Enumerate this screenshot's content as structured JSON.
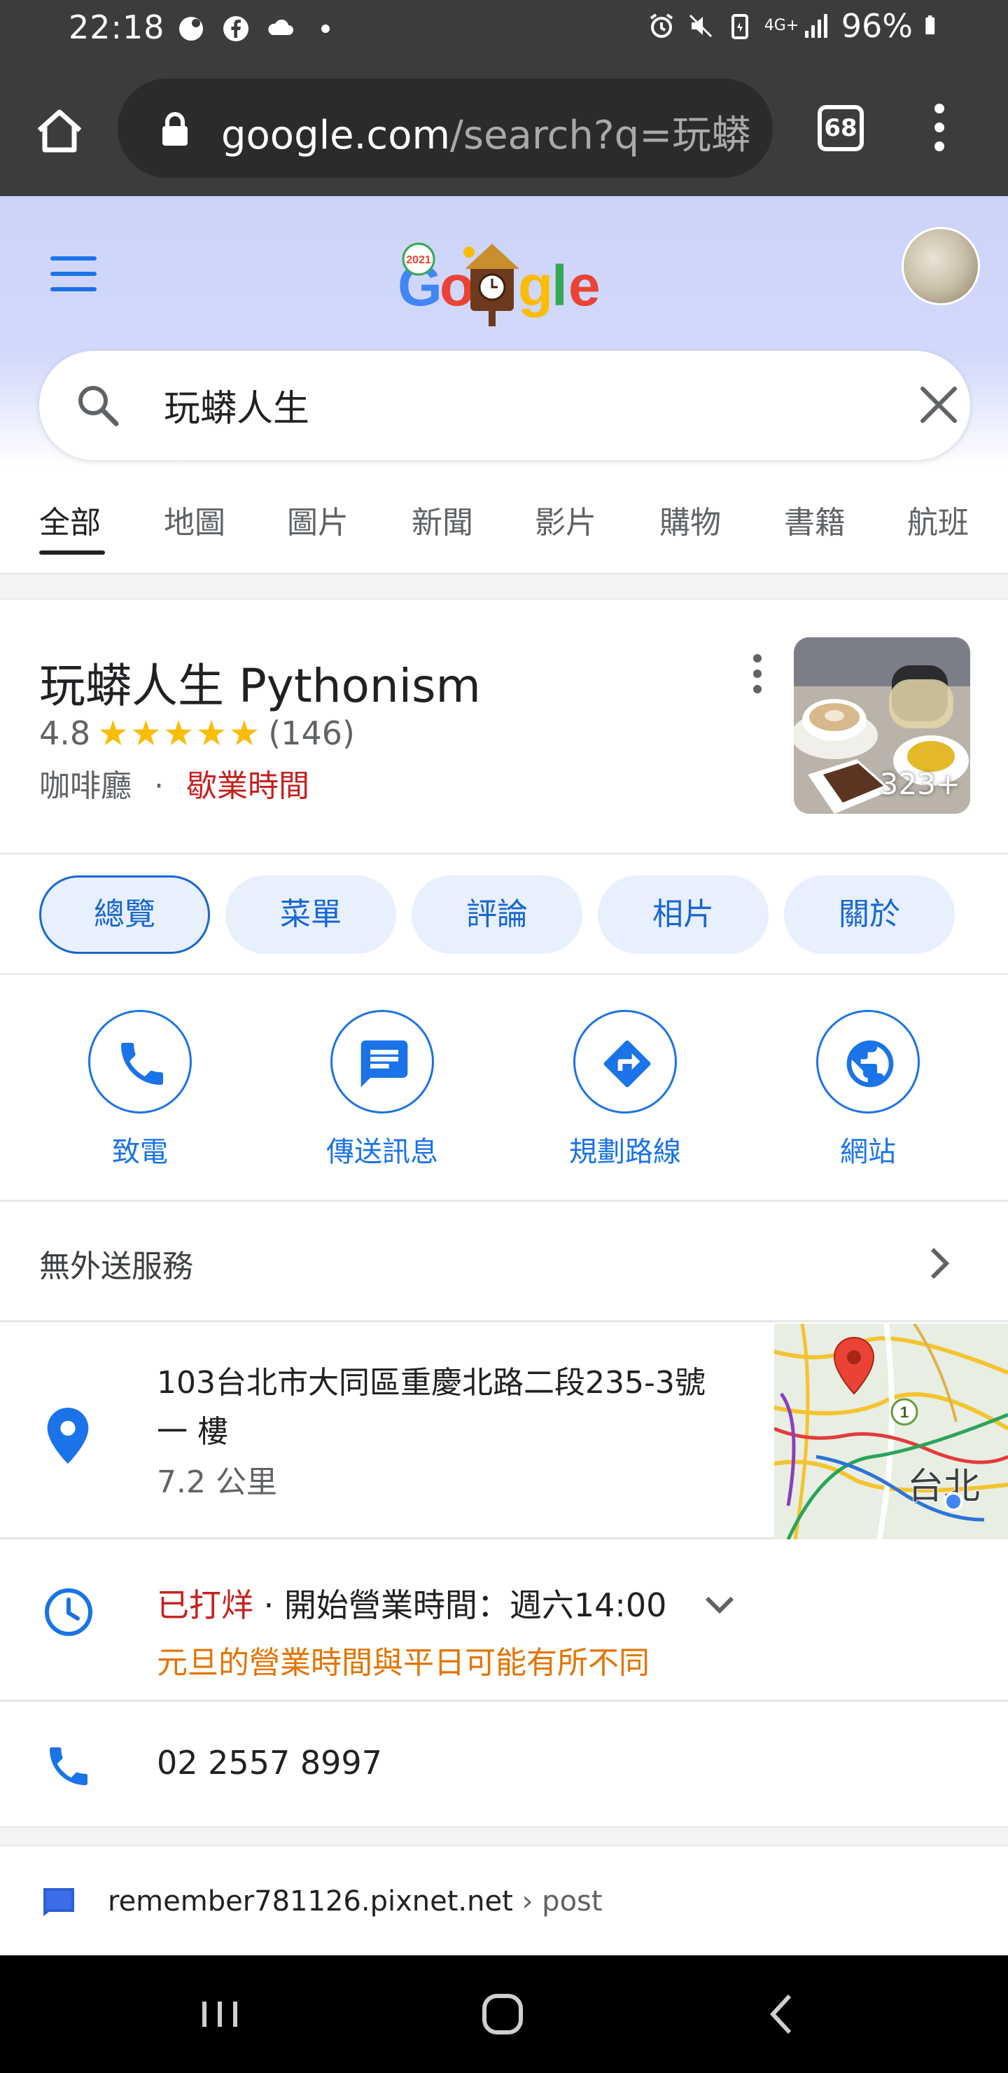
{
  "status_bar": {
    "time": "22:18",
    "battery": "96%",
    "network": "4G+"
  },
  "browser": {
    "url_host": "google.com",
    "url_path": "/search?q=玩蟒",
    "tab_count": "68"
  },
  "search": {
    "query": "玩蟒人生",
    "doodle_year": "2021"
  },
  "tabs": [
    {
      "label": "全部"
    },
    {
      "label": "地圖"
    },
    {
      "label": "圖片"
    },
    {
      "label": "新聞"
    },
    {
      "label": "影片"
    },
    {
      "label": "購物"
    },
    {
      "label": "書籍"
    },
    {
      "label": "航班"
    }
  ],
  "business": {
    "name": "玩蟒人生 Pythonism",
    "rating": "4.8",
    "stars": "★★★★★",
    "review_count": "(146)",
    "category": "咖啡廳",
    "separator": "·",
    "status": "歇業時間",
    "photo_count": "323+"
  },
  "chips": [
    {
      "label": "總覽"
    },
    {
      "label": "菜單"
    },
    {
      "label": "評論"
    },
    {
      "label": "相片"
    },
    {
      "label": "關於"
    }
  ],
  "actions": [
    {
      "label": "致電",
      "icon": "phone-icon"
    },
    {
      "label": "傳送訊息",
      "icon": "message-icon"
    },
    {
      "label": "規劃路線",
      "icon": "directions-icon"
    },
    {
      "label": "網站",
      "icon": "website-icon"
    }
  ],
  "delivery": {
    "text": "無外送服務"
  },
  "address": {
    "line": "103台北市大同區重慶北路二段235-3號一 樓",
    "distance": "7.2 公里",
    "map_label": "台北",
    "map_route_marker": "1"
  },
  "hours": {
    "status": "已打烊",
    "separator": " · ",
    "opening": "開始營業時間：週六14:00",
    "note": "元旦的營業時間與平日可能有所不同"
  },
  "phone": {
    "number": "02 2557 8997"
  },
  "result": {
    "domain": "remember781126.pixnet.net",
    "path": " › post"
  },
  "colors": {
    "google_blue": "#1a73e8",
    "closed_red": "#c5221f",
    "note_orange": "#e37400",
    "star_yellow": "#fbbc04",
    "chrome_dark": "#3c3c3e"
  }
}
